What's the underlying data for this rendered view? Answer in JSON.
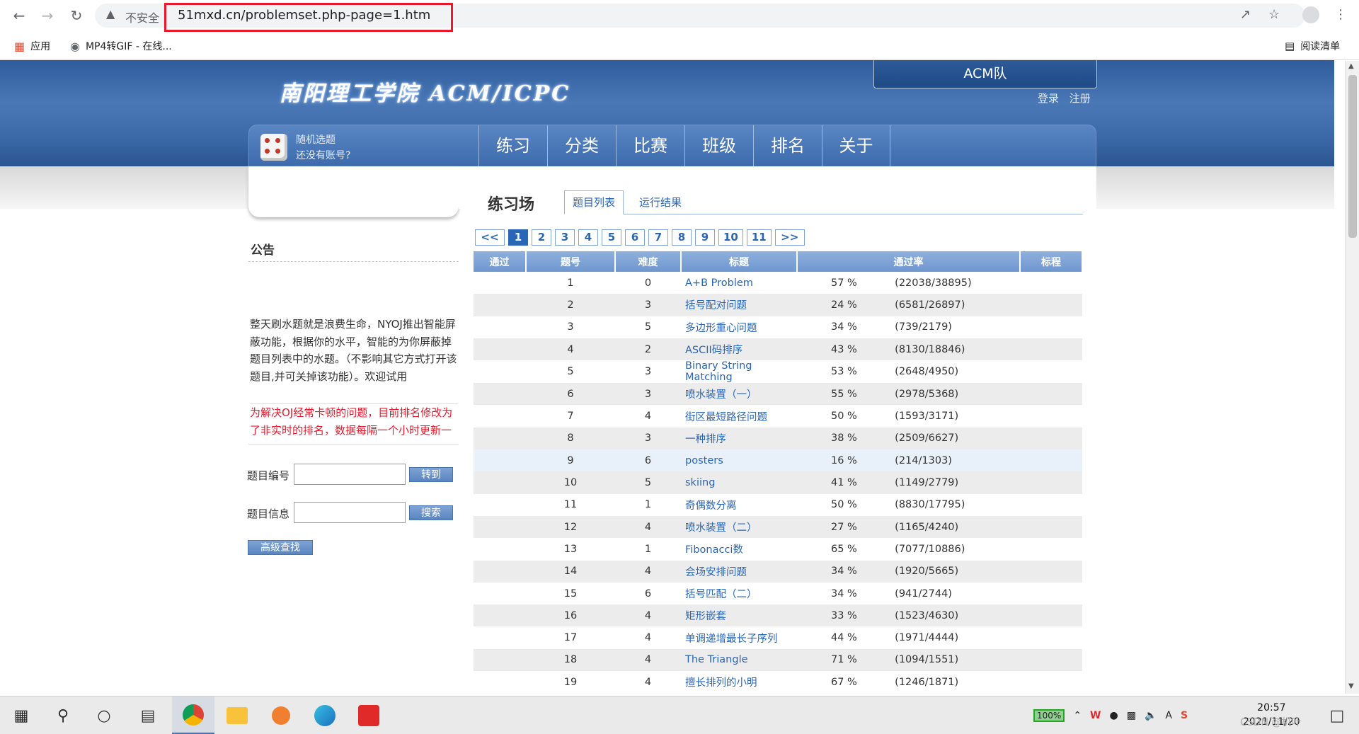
{
  "browser": {
    "security_text": "不安全",
    "url": "51mxd.cn/problemset.php-page=1.htm",
    "bookmarks": [
      {
        "label": "应用",
        "icon": "apps-grid-icon"
      },
      {
        "label": "MP4转GIF - 在线...",
        "icon": "globe-icon"
      }
    ],
    "reading_list": "阅读清单"
  },
  "header": {
    "logo_text": "南阳理工学院 ACM/ICPC",
    "team_label": "ACM队",
    "login": "登录",
    "register": "注册",
    "random_pick": "随机选题",
    "no_account": "还没有账号?",
    "menu": [
      "练习",
      "分类",
      "比赛",
      "班级",
      "排名",
      "关于"
    ]
  },
  "sidebar": {
    "notice_title": "公告",
    "notice_text": "整天刷水题就是浪费生命，NYOJ推出智能屏蔽功能，根据你的水平，智能的为你屏蔽掉题目列表中的水题。（不影响其它方式打开该题目,并可关掉该功能）。欢迎试用",
    "notice_red": "为解决OJ经常卡顿的问题，目前排名修改为了非实时的排名，数据每隔一个小时更新一次",
    "problem_id_label": "题目编号",
    "problem_info_label": "题目信息",
    "goto_button": "转到",
    "search_button": "搜索",
    "advanced_search": "高级查找"
  },
  "main": {
    "title": "练习场",
    "tabs": [
      "题目列表",
      "运行结果"
    ],
    "pager": [
      "<<",
      "1",
      "2",
      "3",
      "4",
      "5",
      "6",
      "7",
      "8",
      "9",
      "10",
      "11",
      ">>"
    ],
    "current_page": "1",
    "columns": [
      "通过",
      "题号",
      "难度",
      "标题",
      "通过率",
      "标程"
    ],
    "rows": [
      {
        "id": "1",
        "diff": "0",
        "title": "A+B Problem",
        "rate": "57 %",
        "ratio": "(22038/38895)"
      },
      {
        "id": "2",
        "diff": "3",
        "title": "括号配对问题",
        "rate": "24 %",
        "ratio": "(6581/26897)"
      },
      {
        "id": "3",
        "diff": "5",
        "title": "多边形重心问题",
        "rate": "34 %",
        "ratio": "(739/2179)"
      },
      {
        "id": "4",
        "diff": "2",
        "title": "ASCII码排序",
        "rate": "43 %",
        "ratio": "(8130/18846)"
      },
      {
        "id": "5",
        "diff": "3",
        "title": "Binary String Matching",
        "rate": "53 %",
        "ratio": "(2648/4950)"
      },
      {
        "id": "6",
        "diff": "3",
        "title": "喷水装置（一）",
        "rate": "55 %",
        "ratio": "(2978/5368)"
      },
      {
        "id": "7",
        "diff": "4",
        "title": "街区最短路径问题",
        "rate": "50 %",
        "ratio": "(1593/3171)"
      },
      {
        "id": "8",
        "diff": "3",
        "title": "一种排序",
        "rate": "38 %",
        "ratio": "(2509/6627)"
      },
      {
        "id": "9",
        "diff": "6",
        "title": "posters",
        "rate": "16 %",
        "ratio": "(214/1303)"
      },
      {
        "id": "10",
        "diff": "5",
        "title": "skiing",
        "rate": "41 %",
        "ratio": "(1149/2779)"
      },
      {
        "id": "11",
        "diff": "1",
        "title": "奇偶数分离",
        "rate": "50 %",
        "ratio": "(8830/17795)"
      },
      {
        "id": "12",
        "diff": "4",
        "title": "喷水装置（二）",
        "rate": "27 %",
        "ratio": "(1165/4240)"
      },
      {
        "id": "13",
        "diff": "1",
        "title": "Fibonacci数",
        "rate": "65 %",
        "ratio": "(7077/10886)"
      },
      {
        "id": "14",
        "diff": "4",
        "title": "会场安排问题",
        "rate": "34 %",
        "ratio": "(1920/5665)"
      },
      {
        "id": "15",
        "diff": "6",
        "title": "括号匹配（二）",
        "rate": "34 %",
        "ratio": "(941/2744)"
      },
      {
        "id": "16",
        "diff": "4",
        "title": "矩形嵌套",
        "rate": "33 %",
        "ratio": "(1523/4630)"
      },
      {
        "id": "17",
        "diff": "4",
        "title": "单调递增最长子序列",
        "rate": "44 %",
        "ratio": "(1971/4444)"
      },
      {
        "id": "18",
        "diff": "4",
        "title": "The Triangle",
        "rate": "71 %",
        "ratio": "(1094/1551)"
      },
      {
        "id": "19",
        "diff": "4",
        "title": "擅长排列的小明",
        "rate": "67 %",
        "ratio": "(1246/1871)"
      }
    ]
  },
  "taskbar": {
    "battery": "100%",
    "time": "20:57",
    "date": "2021/11/20",
    "watermark": "CSDN @机叶"
  },
  "colors": {
    "header_blue": "#3a67a6",
    "link_blue": "#2a66b8",
    "notice_red": "#e8192c",
    "url_highlight": "#e8192c"
  }
}
